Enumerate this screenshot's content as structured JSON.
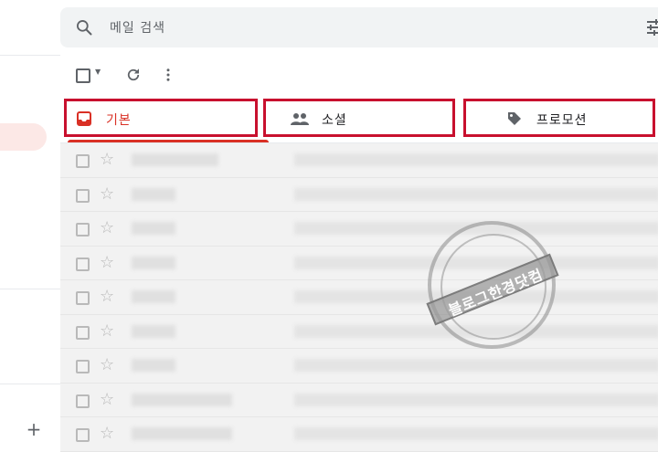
{
  "search": {
    "placeholder": "메일 검색"
  },
  "tabs": [
    {
      "label": "기본",
      "icon": "inbox-icon",
      "active": true
    },
    {
      "label": "소셜",
      "icon": "people-icon",
      "active": false
    },
    {
      "label": "프로모션",
      "icon": "tag-icon",
      "active": false
    }
  ],
  "colors": {
    "accent": "#d93025",
    "highlight_box": "#c8102e"
  },
  "watermark": {
    "text": "블로그한경닷컴"
  },
  "rows": 9
}
